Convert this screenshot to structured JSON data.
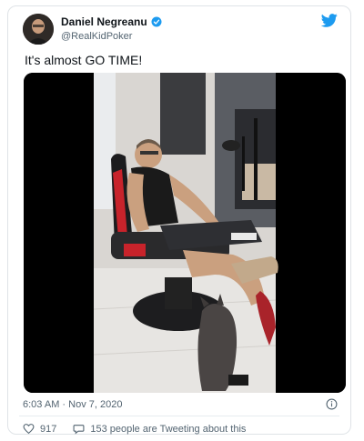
{
  "author": {
    "display_name": "Daniel Negreanu",
    "handle": "@RealKidPoker"
  },
  "tweet": {
    "text": "It's almost GO TIME!",
    "timestamp": "6:03 AM · Nov 7, 2020"
  },
  "actions": {
    "like_count": "917",
    "tweeting_about": "153 people are Tweeting about this"
  },
  "icons": {
    "verified": "verified-badge-icon",
    "brand": "twitter-bird-icon",
    "info": "info-icon",
    "like": "heart-icon",
    "reply": "speech-bubble-icon"
  },
  "colors": {
    "brand_blue": "#1d9bf0",
    "secondary_text": "#536471"
  }
}
